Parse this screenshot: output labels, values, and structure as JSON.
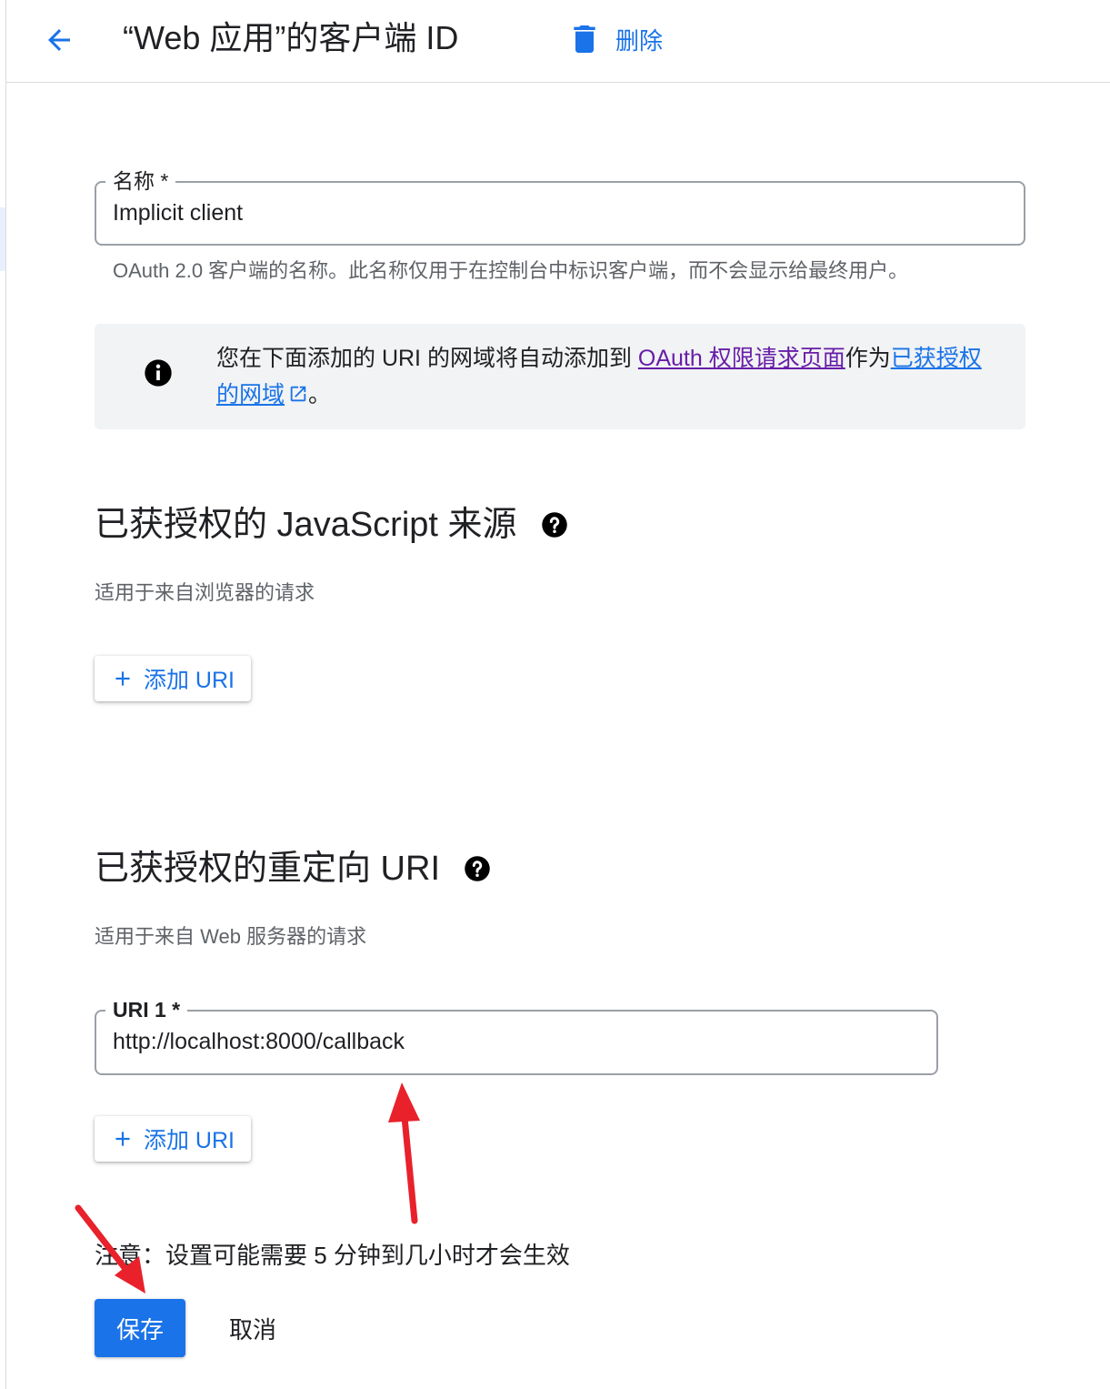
{
  "header": {
    "title": "“Web 应用”的客户端 ID",
    "delete_label": "删除"
  },
  "name_field": {
    "label": "名称 *",
    "value": "Implicit client",
    "hint": "OAuth 2.0 客户端的名称。此名称仅用于在控制台中标识客户端，而不会显示给最终用户。"
  },
  "info": {
    "text_before": "您在下面添加的 URI 的网域将自动添加到 ",
    "link1": "OAuth 权限请求页面",
    "text_middle": "作为",
    "link2": "已获授权的网域",
    "text_after": "。"
  },
  "js_origins": {
    "title": "已获授权的 JavaScript 来源",
    "subtitle": "适用于来自浏览器的请求",
    "add_label": "添加 URI"
  },
  "redirect_uris": {
    "title": "已获授权的重定向 URI",
    "subtitle": "适用于来自 Web 服务器的请求",
    "uri_label": "URI 1 *",
    "uri_value": "http://localhost:8000/callback",
    "add_label": "添加 URI"
  },
  "note": "注意：设置可能需要 5 分钟到几小时才会生效",
  "actions": {
    "save_label": "保存",
    "cancel_label": "取消"
  },
  "colors": {
    "accent": "#1a73e8",
    "link_visited": "#681da8",
    "annotation_arrow": "#e8212b"
  }
}
